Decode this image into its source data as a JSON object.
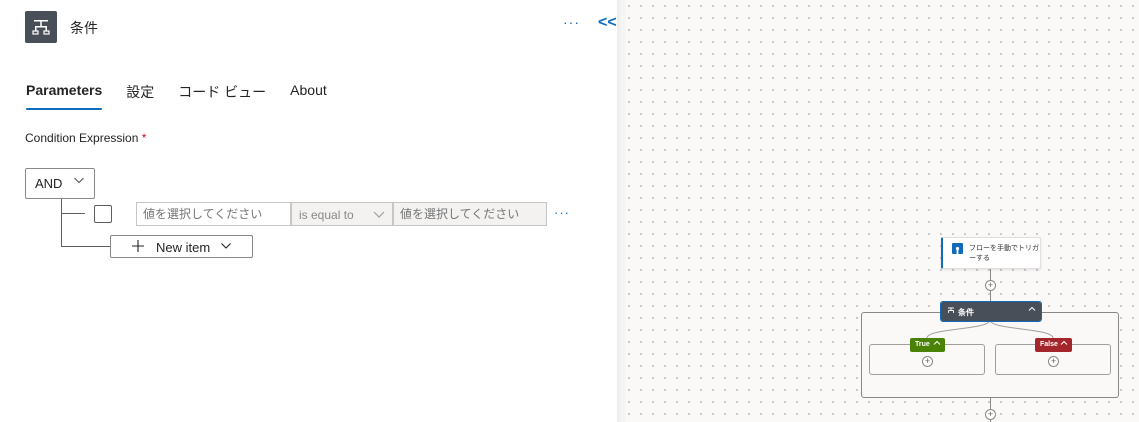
{
  "panel": {
    "title": "条件",
    "more": "···",
    "collapse": "<<",
    "icon": "condition-icon"
  },
  "tabs": [
    {
      "label": "Parameters",
      "active": true
    },
    {
      "label": "設定",
      "active": false
    },
    {
      "label": "コード ビュー",
      "active": false
    },
    {
      "label": "About",
      "active": false
    }
  ],
  "condition": {
    "label": "Condition Expression",
    "required_mark": "*",
    "group_operator": "AND",
    "row": {
      "left_placeholder": "値を選択してください",
      "operator": "is equal to",
      "right_placeholder": "値を選択してください",
      "more": "···"
    },
    "new_item_label": "New item"
  },
  "canvas": {
    "trigger_label": "フローを手動でトリガーする",
    "condition_label": "条件",
    "true_label": "True",
    "false_label": "False",
    "add_symbol": "+"
  },
  "colors": {
    "accent": "#0f6cbd",
    "true_branch": "#498205",
    "false_branch": "#a4262c",
    "condition_header": "#484f58"
  }
}
